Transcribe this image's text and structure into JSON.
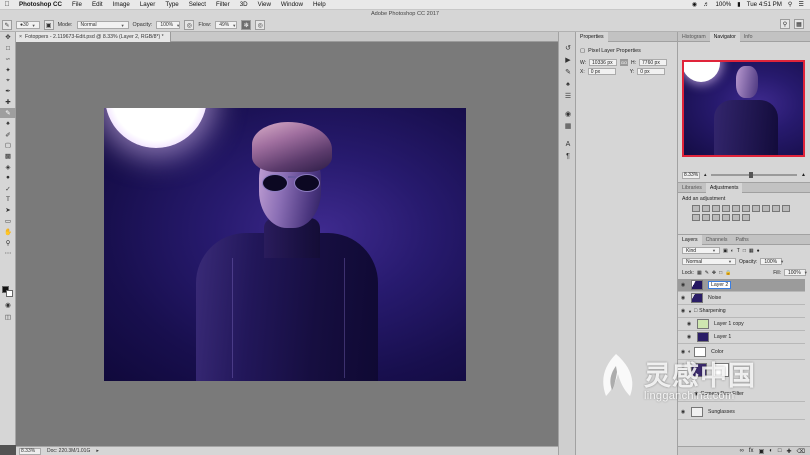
{
  "menubar": {
    "apple": "",
    "items": [
      "Photoshop CC",
      "File",
      "Edit",
      "Image",
      "Layer",
      "Type",
      "Select",
      "Filter",
      "3D",
      "View",
      "Window",
      "Help"
    ],
    "battery": "100%",
    "clock": "Tue 4:51 PM"
  },
  "window": {
    "title": "Adobe Photoshop CC 2017"
  },
  "options": {
    "brush_size": "30",
    "mode_label": "Mode:",
    "mode_value": "Normal",
    "opacity_label": "Opacity:",
    "opacity_value": "100%",
    "flow_label": "Flow:",
    "flow_value": "49%"
  },
  "document": {
    "tab_label": "Fotoppers - 2.119673-Edit.psd @ 8.33% (Layer 2, RGB/8*) *",
    "zoom": "8.33%",
    "doc_info": "Doc: 220.3M/1.01G"
  },
  "properties": {
    "tabs": [
      "Properties"
    ],
    "title": "Pixel Layer Properties",
    "w_label": "W:",
    "w_value": "10336 px",
    "h_label": "H:",
    "h_value": "7760 px",
    "link_label": "GO",
    "x_label": "X:",
    "x_value": "0 px",
    "y_label": "Y:",
    "y_value": "0 px"
  },
  "navigator": {
    "tabs": [
      "Histogram",
      "Navigator",
      "Info"
    ],
    "active_tab": "Navigator",
    "zoom": "8.33%",
    "frame_color": "#e0243a"
  },
  "adjustments": {
    "tabs": [
      "Libraries",
      "Adjustments"
    ],
    "label": "Add an adjustment"
  },
  "layers": {
    "tabs": [
      "Layers",
      "Channels",
      "Paths"
    ],
    "filter_kind": "Kind",
    "blend_mode": "Normal",
    "opacity_label": "Opacity:",
    "opacity_value": "100%",
    "lock_label": "Lock:",
    "fill_label": "Fill:",
    "fill_value": "100%",
    "rows": [
      {
        "name": "Layer 2",
        "selected": true
      },
      {
        "name": "Noise"
      },
      {
        "name": "Sharpening",
        "group": true
      },
      {
        "name": "Layer 1 copy"
      },
      {
        "name": "Layer 1"
      },
      {
        "name": "Color"
      },
      {
        "name": "Camera Raw Filter"
      },
      {
        "name": "Sunglasses"
      }
    ]
  },
  "watermark": {
    "cn": "灵感中国",
    "url": "lingganchina.com"
  }
}
